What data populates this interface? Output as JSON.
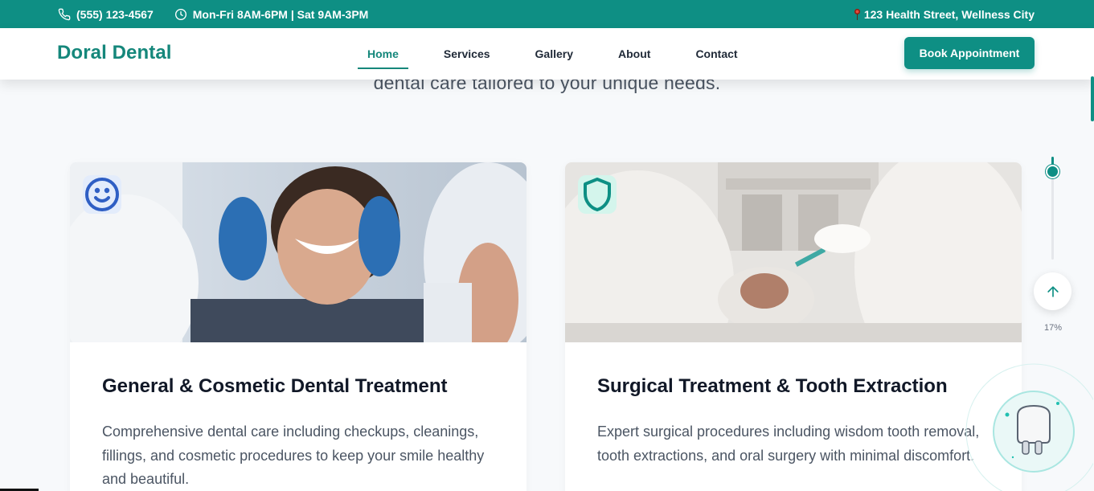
{
  "topbar": {
    "phone": "(555) 123-4567",
    "hours": "Mon-Fri 8AM-6PM | Sat 9AM-3PM",
    "address": "123 Health Street, Wellness City"
  },
  "header": {
    "logo": "Doral Dental",
    "nav": [
      {
        "label": "Home",
        "active": true
      },
      {
        "label": "Services",
        "active": false
      },
      {
        "label": "Gallery",
        "active": false
      },
      {
        "label": "About",
        "active": false
      },
      {
        "label": "Contact",
        "active": false
      }
    ],
    "cta_label": "Book Appointment"
  },
  "hero": {
    "subtitle": "dental care tailored to your unique needs."
  },
  "services": [
    {
      "icon": "smile-icon",
      "title": "General & Cosmetic Dental Treatment",
      "description": "Comprehensive dental care including checkups, cleanings, fillings, and cosmetic procedures to keep your smile healthy and beautiful."
    },
    {
      "icon": "shield-icon",
      "title": "Surgical Treatment & Tooth Extraction",
      "description": "Expert surgical procedures including wisdom tooth removal, tooth extractions, and oral surgery with minimal discomfort."
    }
  ],
  "scroll": {
    "percent_label": "17%",
    "progress_fraction": 0.17
  },
  "colors": {
    "brand": "#0e8f84",
    "brand_text": "#15877b"
  }
}
